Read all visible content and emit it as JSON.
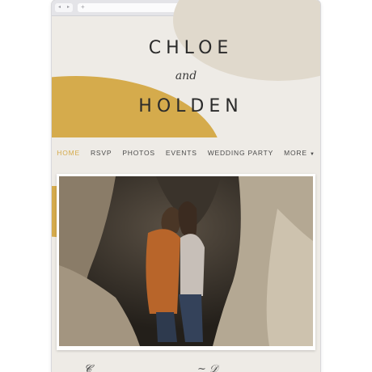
{
  "browser": {
    "address_placeholder": "+",
    "reload_icon": "reload-icon",
    "search_icon": "search-icon"
  },
  "hero": {
    "name_first": "CHLOE",
    "conjunction": "and",
    "name_second": "HOLDEN"
  },
  "nav": {
    "items": [
      {
        "label": "HOME",
        "active": true
      },
      {
        "label": "RSVP",
        "active": false
      },
      {
        "label": "PHOTOS",
        "active": false
      },
      {
        "label": "EVENTS",
        "active": false
      },
      {
        "label": "WEDDING PARTY",
        "active": false
      },
      {
        "label": "MORE",
        "active": false
      }
    ]
  },
  "colors": {
    "accent_gold": "#d5ab4c",
    "accent_tan": "#e0d9cc",
    "background": "#eeebe6",
    "text": "#2b2b2b"
  },
  "photo": {
    "subject": "couple-embracing-in-cave-photo"
  }
}
